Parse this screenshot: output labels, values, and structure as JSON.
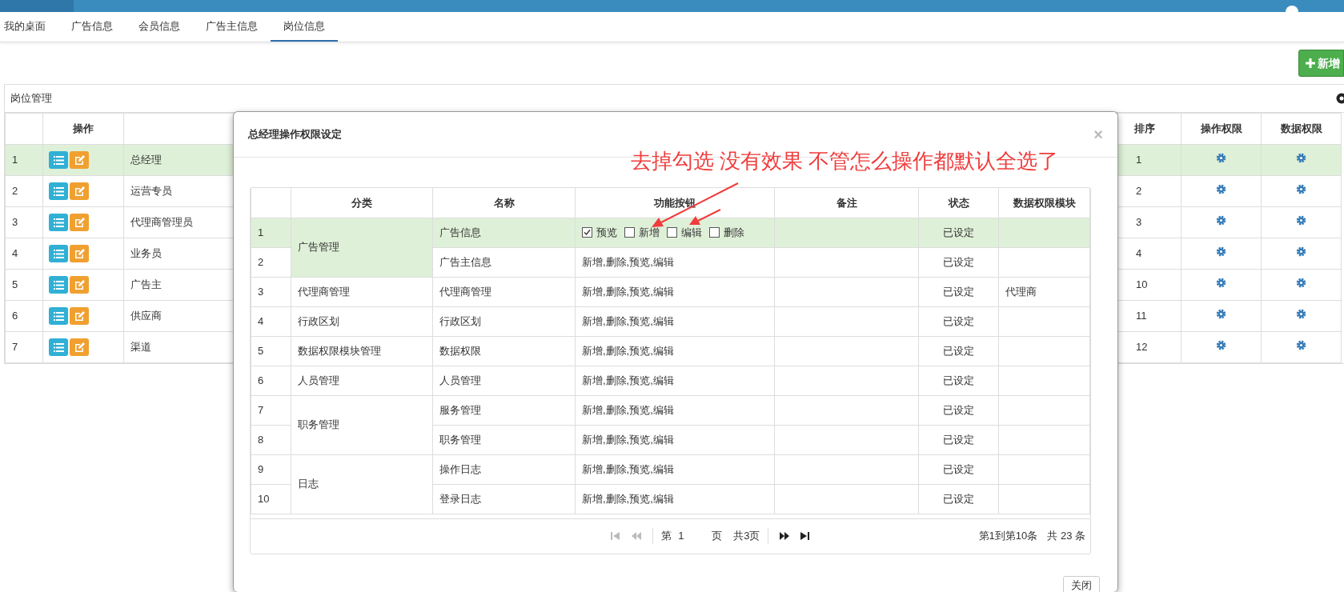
{
  "tabs": [
    {
      "label": "我的桌面",
      "selected": false
    },
    {
      "label": "广告信息",
      "selected": false
    },
    {
      "label": "会员信息",
      "selected": false
    },
    {
      "label": "广告主信息",
      "selected": false
    },
    {
      "label": "岗位信息",
      "selected": true
    }
  ],
  "add_button": "新增",
  "panel": {
    "title": "岗位管理",
    "columns": {
      "actions": "操作",
      "sort": "排序",
      "op_perm": "操作权限",
      "data_perm": "数据权限"
    },
    "rows": [
      {
        "index": "1",
        "name": "总经理",
        "sort": "1",
        "selected": true
      },
      {
        "index": "2",
        "name": "运营专员",
        "sort": "2",
        "selected": false
      },
      {
        "index": "3",
        "name": "代理商管理员",
        "sort": "3",
        "selected": false
      },
      {
        "index": "4",
        "name": "业务员",
        "sort": "4",
        "selected": false
      },
      {
        "index": "5",
        "name": "广告主",
        "sort": "10",
        "selected": false
      },
      {
        "index": "6",
        "name": "供应商",
        "sort": "11",
        "selected": false
      },
      {
        "index": "7",
        "name": "渠道",
        "sort": "12",
        "selected": false
      }
    ]
  },
  "modal": {
    "title": "总经理操作权限设定",
    "close": "×",
    "table": {
      "columns": [
        "分类",
        "名称",
        "功能按钮",
        "备注",
        "状态",
        "数据权限模块"
      ],
      "groups": [
        {
          "category": "广告管理",
          "items": [
            {
              "index": "1",
              "name": "广告信息",
              "kind": "checkboxes",
              "options": [
                {
                  "label": "预览",
                  "checked": true
                },
                {
                  "label": "新增",
                  "checked": false
                },
                {
                  "label": "编辑",
                  "checked": false
                },
                {
                  "label": "删除",
                  "checked": false
                }
              ],
              "status": "已设定",
              "selected": true
            },
            {
              "index": "2",
              "name": "广告主信息",
              "kind": "text",
              "functions": "新增,删除,预览,编辑",
              "status": "已设定",
              "selected": false
            }
          ]
        },
        {
          "category": "代理商管理",
          "items": [
            {
              "index": "3",
              "name": "代理商管理",
              "kind": "text",
              "functions": "新增,删除,预览,编辑",
              "status": "已设定",
              "data_module": "代理商",
              "selected": false
            }
          ]
        },
        {
          "category": "行政区划",
          "items": [
            {
              "index": "4",
              "name": "行政区划",
              "kind": "text",
              "functions": "新增,删除,预览,编辑",
              "status": "已设定",
              "selected": false
            }
          ]
        },
        {
          "category": "数据权限模块管理",
          "items": [
            {
              "index": "5",
              "name": "数据权限",
              "kind": "text",
              "functions": "新增,删除,预览,编辑",
              "status": "已设定",
              "selected": false
            }
          ]
        },
        {
          "category": "人员管理",
          "items": [
            {
              "index": "6",
              "name": "人员管理",
              "kind": "text",
              "functions": "新增,删除,预览,编辑",
              "status": "已设定",
              "selected": false
            }
          ]
        },
        {
          "category": "职务管理",
          "items": [
            {
              "index": "7",
              "name": "服务管理",
              "kind": "text",
              "functions": "新增,删除,预览,编辑",
              "status": "已设定",
              "selected": false
            },
            {
              "index": "8",
              "name": "职务管理",
              "kind": "text",
              "functions": "新增,删除,预览,编辑",
              "status": "已设定",
              "selected": false
            }
          ]
        },
        {
          "category": "日志",
          "items": [
            {
              "index": "9",
              "name": "操作日志",
              "kind": "text",
              "functions": "新增,删除,预览,编辑",
              "status": "已设定",
              "selected": false
            },
            {
              "index": "10",
              "name": "登录日志",
              "kind": "text",
              "functions": "新增,删除,预览,编辑",
              "status": "已设定",
              "selected": false
            }
          ]
        }
      ]
    },
    "pagination": {
      "buttons": [
        {
          "kind": "first",
          "disabled": true
        },
        {
          "kind": "prev",
          "disabled": true
        },
        {
          "kind": "next",
          "disabled": false
        },
        {
          "kind": "last",
          "disabled": false
        }
      ],
      "page_prefix": "第",
      "page_value": "1",
      "page_suffix": "页",
      "total_pages": "共3页",
      "range": "第1到第10条",
      "total": "共 23 条"
    },
    "close_button": "关闭"
  },
  "annotation": "去掉勾选 没有效果 不管怎么操作都默认全选了"
}
